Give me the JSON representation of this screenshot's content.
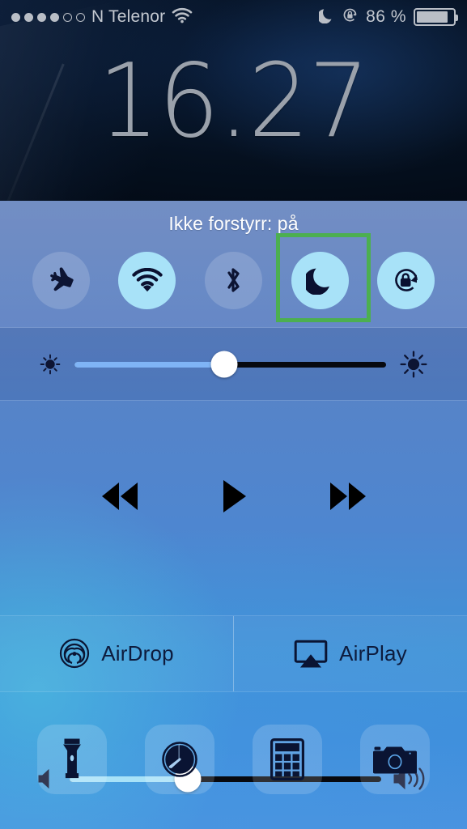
{
  "status_bar": {
    "signal_dots_filled": 4,
    "signal_dots_total": 6,
    "carrier": "N Telenor",
    "wifi_icon": "wifi-icon",
    "dnd_icon": "moon-icon",
    "rotation_lock_icon": "rotation-lock-icon",
    "battery_percent": "86 %",
    "battery_level": 86,
    "battery_icon": "battery-icon"
  },
  "lockscreen": {
    "time": "16.27"
  },
  "control_center": {
    "dnd_status_label": "Ikke forstyrr: på",
    "toggles": [
      {
        "name": "airplane-mode",
        "icon": "airplane-icon",
        "state": "off",
        "highlighted": false
      },
      {
        "name": "wifi",
        "icon": "wifi-icon",
        "state": "on",
        "highlighted": false
      },
      {
        "name": "bluetooth",
        "icon": "bluetooth-icon",
        "state": "off",
        "highlighted": false
      },
      {
        "name": "do-not-disturb",
        "icon": "moon-icon",
        "state": "on",
        "highlighted": true
      },
      {
        "name": "rotation-lock",
        "icon": "rotation-lock-icon",
        "state": "on",
        "highlighted": false
      }
    ],
    "highlight_color": "#4caf50",
    "brightness": {
      "label_left_icon": "brightness-low-icon",
      "label_right_icon": "brightness-high-icon",
      "value_percent": 48,
      "fill_color": "#7fb4f5"
    },
    "media": {
      "previous_label": "previous-track",
      "play_label": "play",
      "next_label": "next-track",
      "is_playing": false
    },
    "volume": {
      "label_left_icon": "volume-mute-icon",
      "label_right_icon": "volume-high-icon",
      "value_percent": 38,
      "fill_color": "#a8e2f8"
    },
    "sharing": [
      {
        "label": "AirDrop",
        "icon": "airdrop-icon"
      },
      {
        "label": "AirPlay",
        "icon": "airplay-icon"
      }
    ],
    "shortcuts": [
      {
        "name": "flashlight",
        "icon": "flashlight-icon"
      },
      {
        "name": "timer",
        "icon": "timer-icon"
      },
      {
        "name": "calculator",
        "icon": "calculator-icon"
      },
      {
        "name": "camera",
        "icon": "camera-icon"
      }
    ]
  }
}
